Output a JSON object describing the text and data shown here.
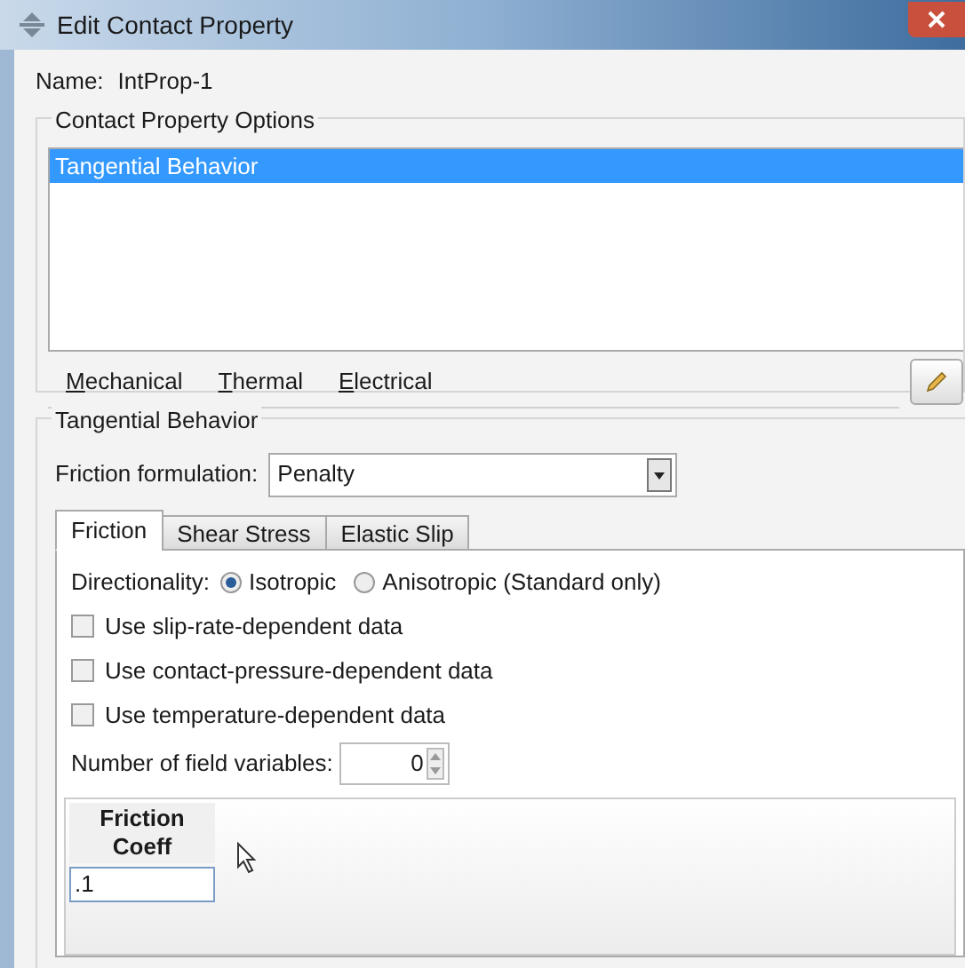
{
  "window": {
    "title": "Edit Contact Property"
  },
  "name": {
    "label": "Name:",
    "value": "IntProp-1"
  },
  "options_group": {
    "title": "Contact Property Options",
    "items": [
      {
        "label": "Tangential Behavior",
        "selected": true
      }
    ]
  },
  "menu": [
    "Mechanical",
    "Thermal",
    "Electrical"
  ],
  "behavior_group": {
    "title": "Tangential Behavior",
    "formulation_label": "Friction formulation:",
    "formulation_value": "Penalty"
  },
  "tabs": [
    {
      "label": "Friction",
      "selected": true
    },
    {
      "label": "Shear Stress",
      "selected": false
    },
    {
      "label": "Elastic Slip",
      "selected": false
    }
  ],
  "directionality": {
    "label": "Directionality:",
    "options": [
      {
        "label": "Isotropic",
        "selected": true
      },
      {
        "label": "Anisotropic (Standard only)",
        "selected": false
      }
    ]
  },
  "checkboxes": [
    {
      "label": "Use slip-rate-dependent data",
      "checked": false
    },
    {
      "label": "Use contact-pressure-dependent data",
      "checked": false
    },
    {
      "label": "Use temperature-dependent data",
      "checked": false
    }
  ],
  "field_variables": {
    "label": "Number of field variables:",
    "value": "0"
  },
  "table": {
    "columns": [
      "Friction Coeff"
    ],
    "rows": [
      [
        ".1"
      ]
    ]
  }
}
